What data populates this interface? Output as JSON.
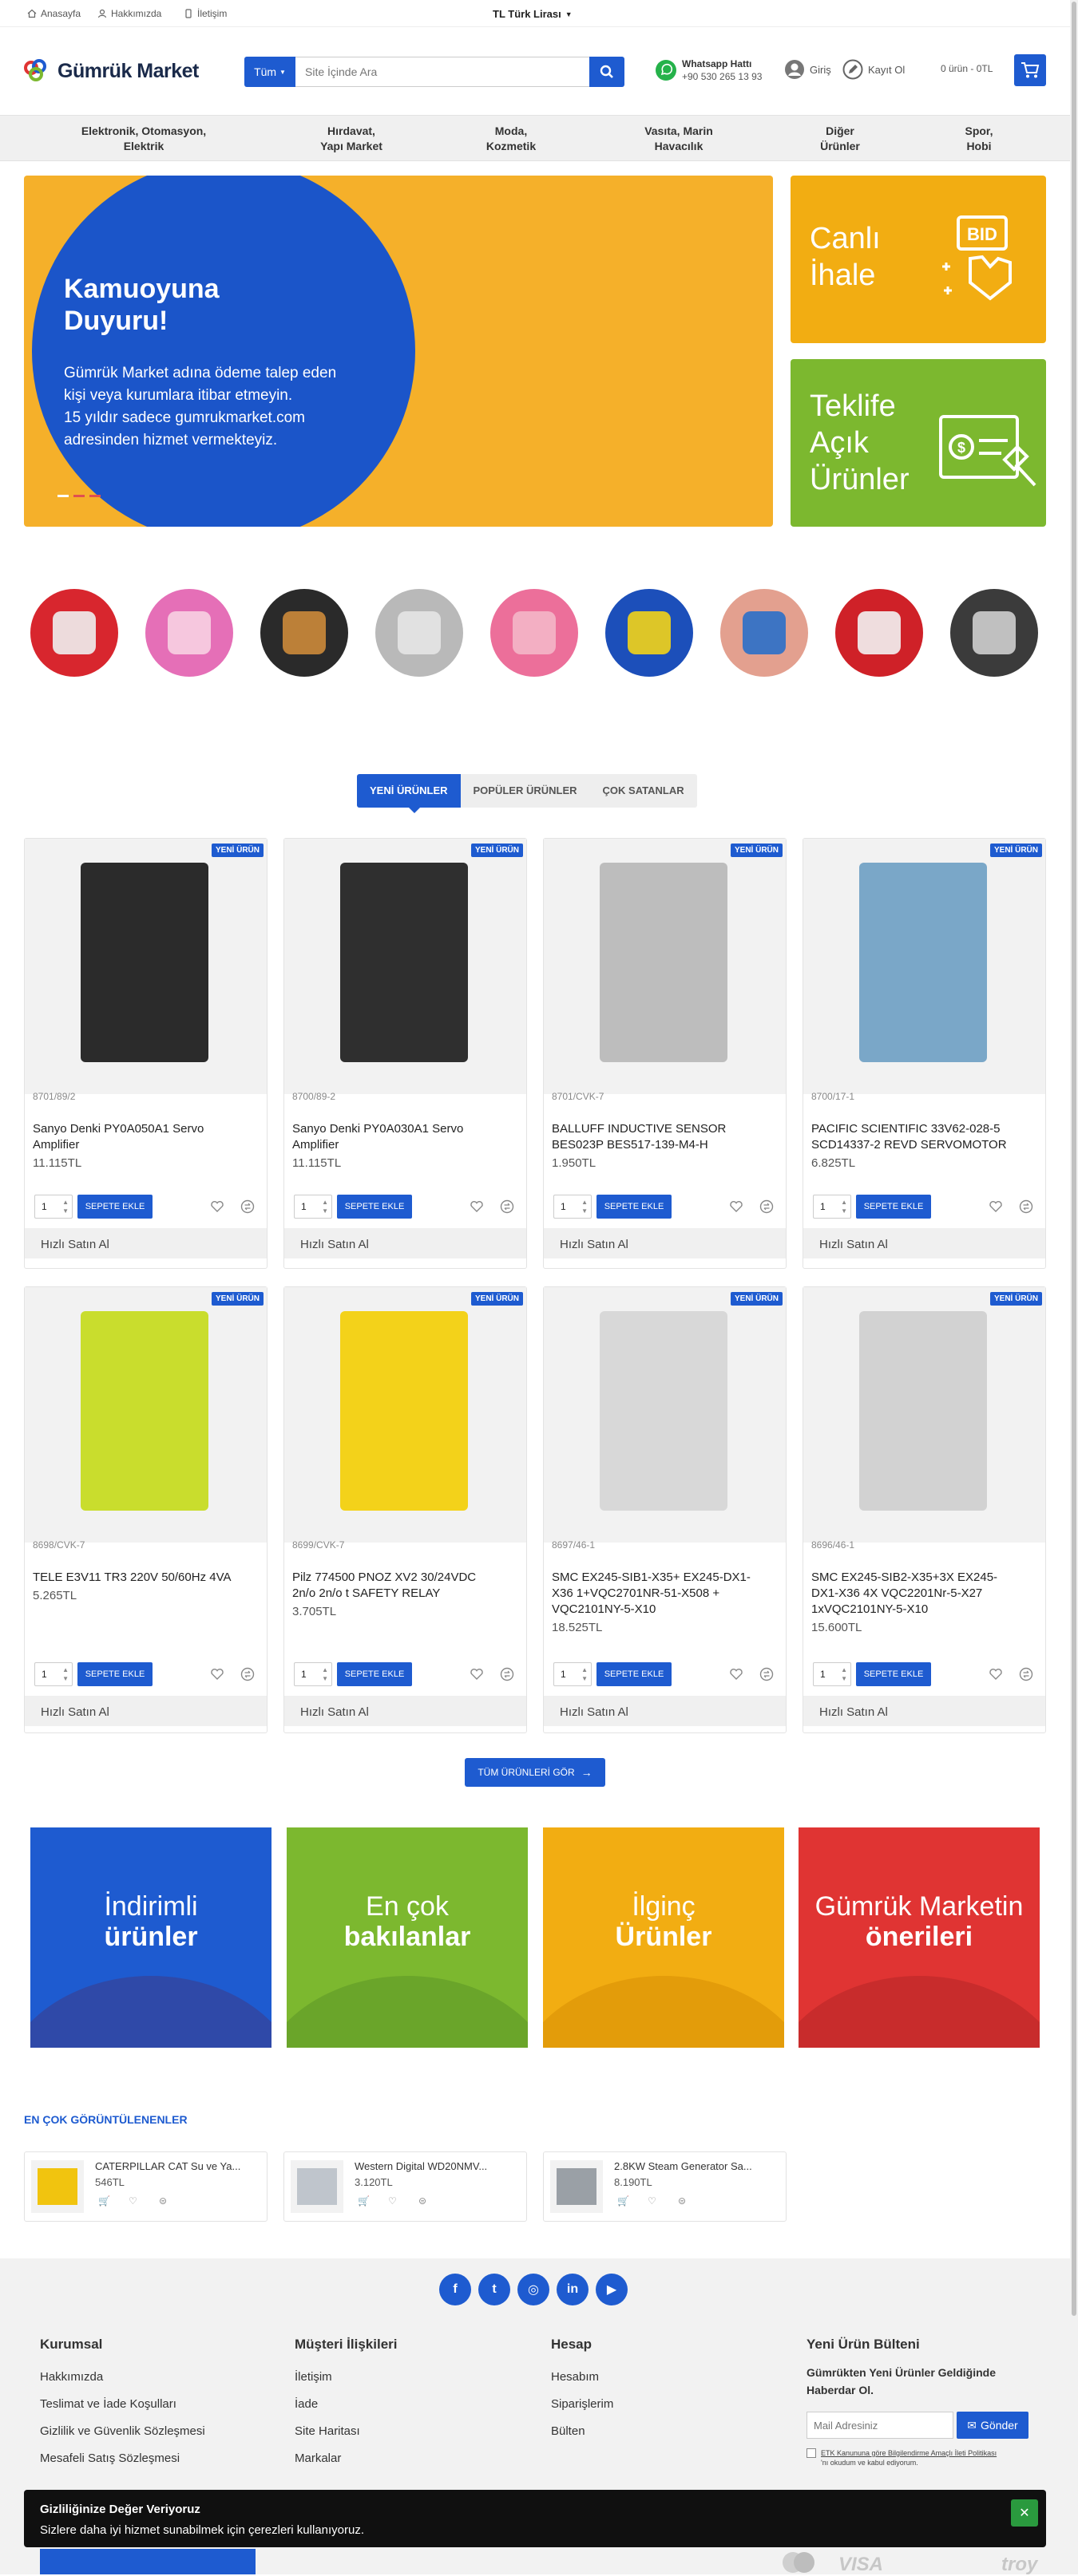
{
  "topbar": {
    "links": [
      "Anasayfa",
      "Hakkımızda",
      "İletişim"
    ],
    "currency": "TL  Türk Lirası"
  },
  "header": {
    "logo_text": "Gümrük Market",
    "search_category": "Tüm",
    "search_placeholder": "Site İçinde Ara",
    "whatsapp_label": "Whatsapp Hattı",
    "whatsapp_number": "+90 530 265 13 93",
    "login": "Giriş",
    "register": "Kayıt Ol",
    "cart_summary": "0 ürün - 0TL"
  },
  "category_nav": [
    {
      "l1": "Elektronik, Otomasyon,",
      "l2": "Elektrik"
    },
    {
      "l1": "Hırdavat,",
      "l2": "Yapı Market"
    },
    {
      "l1": "Moda,",
      "l2": "Kozmetik"
    },
    {
      "l1": "Vasıta, Marin",
      "l2": "Havacılık"
    },
    {
      "l1": "Diğer",
      "l2": "Ürünler"
    },
    {
      "l1": "Spor,",
      "l2": "Hobi"
    }
  ],
  "hero": {
    "title_l1": "Kamuoyuna",
    "title_l2": "Duyuru!",
    "body_l1": "Gümrük Market adına ödeme talep eden",
    "body_l2": "kişi veya kurumlara itibar etmeyin.",
    "body_l3": "15 yıldır sadece gumrukmarket.com",
    "body_l4": "adresinden hizmet vermekteyiz."
  },
  "side_banners": [
    {
      "l1": "Canlı",
      "l2": "İhale",
      "l3": "",
      "icon_text": "BID",
      "color": "#f2ad12"
    },
    {
      "l1": "Teklife",
      "l2": "Açık",
      "l3": "Ürünler",
      "icon_text": "$",
      "color": "#7cb82f"
    }
  ],
  "category_circles": [
    {
      "name": "electronics",
      "bg": "#d8262e",
      "fg": "#f0f0f0"
    },
    {
      "name": "cosmetics",
      "bg": "#e56fb7",
      "fg": "#f7d0e2"
    },
    {
      "name": "watch",
      "bg": "#2a2a2a",
      "fg": "#cc8a3a"
    },
    {
      "name": "classic-car",
      "bg": "#b9b9b9",
      "fg": "#e6e6e6"
    },
    {
      "name": "teddy-bear",
      "bg": "#ec6f9a",
      "fg": "#f4b6c8"
    },
    {
      "name": "polo-shirt",
      "bg": "#1c4fba",
      "fg": "#f3d318"
    },
    {
      "name": "cable",
      "bg": "#e3a08f",
      "fg": "#2a6fc9"
    },
    {
      "name": "hammer-drill",
      "bg": "#cf2128",
      "fg": "#f2f2f2"
    },
    {
      "name": "pos-terminal",
      "bg": "#3b3b3b",
      "fg": "#cfcfcf"
    }
  ],
  "tabs": [
    "YENİ ÜRÜNLER",
    "POPÜLER ÜRÜNLER",
    "ÇOK SATANLAR"
  ],
  "badge_label": "YENİ ÜRÜN",
  "add_to_cart": "SEPETE EKLE",
  "quick_buy": "Hızlı Satın Al",
  "qty_default": "1",
  "products": [
    {
      "code": "8701/89/2",
      "name_l1": "Sanyo Denki PY0A050A1 Servo",
      "name_l2": "Amplifier",
      "name_l3": "",
      "price": "11.115TL"
    },
    {
      "code": "8700/89-2",
      "name_l1": "Sanyo Denki PY0A030A1 Servo",
      "name_l2": "Amplifier",
      "name_l3": "",
      "price": "11.115TL"
    },
    {
      "code": "8701/CVK-7",
      "name_l1": "BALLUFF INDUCTIVE SENSOR",
      "name_l2": "BES023P BES517-139-M4-H",
      "name_l3": "",
      "price": "1.950TL"
    },
    {
      "code": "8700/17-1",
      "name_l1": "PACIFIC SCIENTIFIC 33V62-028-5",
      "name_l2": "SCD14337-2 REVD SERVOMOTOR",
      "name_l3": "",
      "price": "6.825TL"
    },
    {
      "code": "8698/CVK-7",
      "name_l1": "TELE E3V11 TR3 220V 50/60Hz 4VA",
      "name_l2": "",
      "name_l3": "",
      "price": "5.265TL"
    },
    {
      "code": "8699/CVK-7",
      "name_l1": "Pilz 774500 PNOZ XV2 30/24VDC",
      "name_l2": "2n/o 2n/o t SAFETY RELAY",
      "name_l3": "",
      "price": "3.705TL"
    },
    {
      "code": "8697/46-1",
      "name_l1": "SMC EX245-SIB1-X35+ EX245-DX1-",
      "name_l2": "X36 1+VQC2701NR-51-X508 +",
      "name_l3": "VQC2101NY-5-X10",
      "price": "18.525TL"
    },
    {
      "code": "8696/46-1",
      "name_l1": "SMC EX245-SIB2-X35+3X EX245-",
      "name_l2": "DX1-X36 4X VQC2201Nr-5-X27",
      "name_l3": "1xVQC2101NY-5-X10",
      "price": "15.600TL"
    }
  ],
  "all_products_button": "TÜM ÜRÜNLERİ GÖR",
  "feature_tiles": [
    {
      "l1": "İndirimli",
      "l2": "ürünler",
      "color": "#1e5bd0",
      "bowl": "#2f49a8"
    },
    {
      "l1": "En çok",
      "l2": "bakılanlar",
      "color": "#7cb82f",
      "bowl": "#6aa52a"
    },
    {
      "l1": "İlginç",
      "l2": "Ürünler",
      "color": "#f2ad12",
      "bowl": "#e39c0a"
    },
    {
      "l1": "Gümrük Marketin",
      "l2": "önerileri",
      "color": "#e03433",
      "bowl": "#c82c2c"
    }
  ],
  "most_viewed_title": "EN ÇOK GÖRÜNTÜLENENLER",
  "most_viewed": [
    {
      "name": "CATERPILLAR CAT Su ve Ya...",
      "price": "546TL",
      "thumb": "#f1c40f"
    },
    {
      "name": "Western Digital WD20NMV...",
      "price": "3.120TL",
      "thumb": "#bfc5cc"
    },
    {
      "name": "2.8KW Steam Generator Sa...",
      "price": "8.190TL",
      "thumb": "#9aa0a6"
    }
  ],
  "social_icons": [
    "facebook-icon",
    "twitter-icon",
    "instagram-icon",
    "linkedin-icon",
    "youtube-icon"
  ],
  "footer": {
    "col1": {
      "title": "Kurumsal",
      "links": [
        "Hakkımızda",
        "Teslimat ve İade Koşulları",
        "Gizlilik ve Güvenlik Sözleşmesi",
        "Mesafeli Satış Sözleşmesi"
      ]
    },
    "col2": {
      "title": "Müşteri İlişkileri",
      "links": [
        "İletişim",
        "İade",
        "Site Haritası",
        "Markalar"
      ]
    },
    "col3": {
      "title": "Hesap",
      "links": [
        "Hesabım",
        "Siparişlerim",
        "Bülten"
      ]
    },
    "col4": {
      "title": "Yeni Ürün Bülteni",
      "desc_l1": "Gümrükten Yeni Ürünler Geldiğinde",
      "desc_l2": "Haberdar Ol.",
      "email_placeholder": "Mail Adresiniz",
      "send": "Gönder",
      "consent_l1": "ETK Kanununa göre Bilgilendirme Amaçlı İleti Politikası",
      "consent_l2": "'nı okudum ve kabul ediyorum."
    }
  },
  "cookie": {
    "title": "Gizliliğinize Değer Veriyoruz",
    "text": "Sizlere daha iyi hizmet sunabilmek için çerezleri kullanıyoruz."
  },
  "payment_logos": [
    "VISA",
    "troy"
  ]
}
